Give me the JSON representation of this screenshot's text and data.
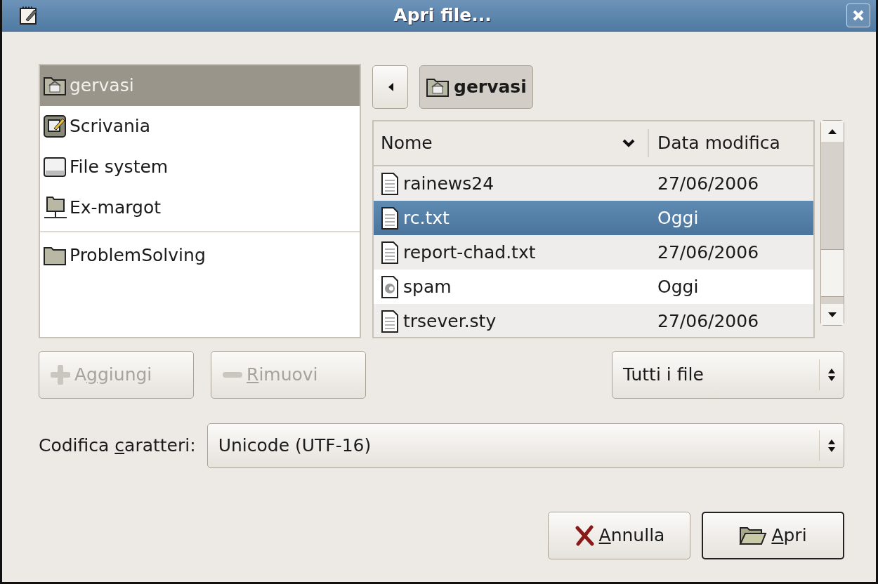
{
  "window": {
    "title": "Apri file..."
  },
  "sidebar": {
    "places": [
      {
        "label": "gervasi",
        "kind": "home",
        "selected": true
      },
      {
        "label": "Scrivania",
        "kind": "desktop",
        "selected": false
      },
      {
        "label": "File system",
        "kind": "drive",
        "selected": false
      },
      {
        "label": "Ex-margot",
        "kind": "network",
        "selected": false
      }
    ],
    "bookmarks": [
      {
        "label": "ProblemSolving",
        "kind": "folder",
        "selected": false
      }
    ]
  },
  "path_bar": {
    "segments": [
      {
        "label": "gervasi",
        "selected": true
      }
    ]
  },
  "file_list": {
    "columns": [
      {
        "label": "Nome",
        "sorted": true
      },
      {
        "label": "Data modifica",
        "sorted": false
      }
    ],
    "rows": [
      {
        "name": "rainews24",
        "modified": "27/06/2006",
        "kind": "document",
        "selected": false
      },
      {
        "name": "rc.txt",
        "modified": "Oggi",
        "kind": "document",
        "selected": true
      },
      {
        "name": "report-chad.txt",
        "modified": "27/06/2006",
        "kind": "document",
        "selected": false
      },
      {
        "name": "spam",
        "modified": "Oggi",
        "kind": "script",
        "selected": false
      },
      {
        "name": "trsever.sty",
        "modified": "27/06/2006",
        "kind": "document",
        "selected": false
      }
    ]
  },
  "bookmark_buttons": [
    {
      "before": "A",
      "accel": "g",
      "after": "giungi",
      "kind": "add",
      "disabled": true
    },
    {
      "accel": "R",
      "after": "imuovi",
      "kind": "remove",
      "disabled": true
    }
  ],
  "filter": {
    "value": "Tutti i file"
  },
  "encoding": {
    "label": {
      "before": "Codifica ",
      "accel": "c",
      "after": "aratteri:"
    },
    "value": "Unicode (UTF-16)"
  },
  "actions": [
    {
      "accel": "A",
      "after": "nnulla",
      "kind": "cancel",
      "default": false
    },
    {
      "accel": "A",
      "after": "pri",
      "kind": "open",
      "default": true
    }
  ]
}
